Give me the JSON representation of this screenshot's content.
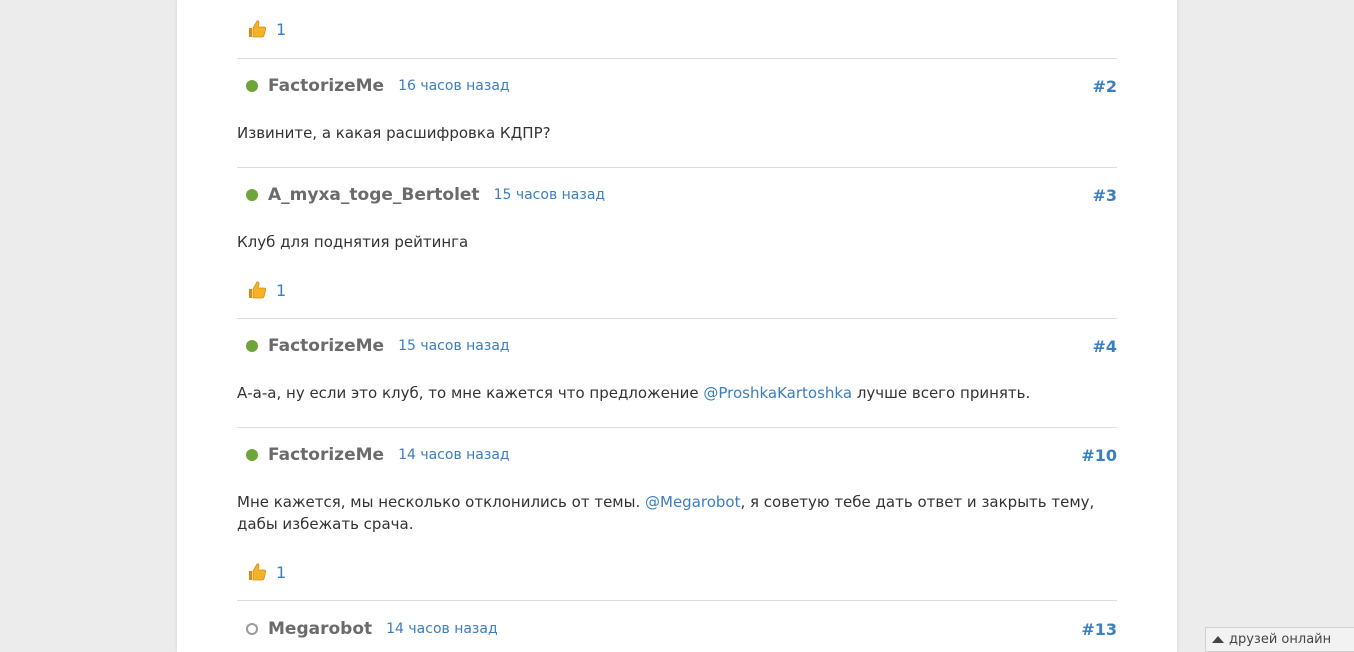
{
  "top_likes": {
    "count": "1"
  },
  "posts": [
    {
      "author": "FactorizeMe",
      "time": "16 часов назад",
      "number": "#2",
      "status": "online",
      "body": "Извините, а какая расшифровка КДПР?",
      "likes": null
    },
    {
      "author": "A_myxa_toge_Bertolet",
      "time": "15 часов назад",
      "number": "#3",
      "status": "online",
      "body": "Клуб для поднятия рейтинга",
      "likes": "1"
    },
    {
      "author": "FactorizeMe",
      "time": "15 часов назад",
      "number": "#4",
      "status": "online",
      "body_before": "А-а-а, ну если это клуб, то мне кажется что предложение ",
      "mention": "@ProshkaKartoshka",
      "body_after": " лучше всего принять.",
      "likes": null
    },
    {
      "author": "FactorizeMe",
      "time": "14 часов назад",
      "number": "#10",
      "status": "online",
      "body_before": "Мне кажется, мы несколько отклонились от темы. ",
      "mention": "@Megarobot",
      "body_after": ", я советую тебе дать ответ и закрыть тему, дабы избежать срача.",
      "likes": "1"
    },
    {
      "author": "Megarobot",
      "time": "14 часов назад",
      "number": "#13",
      "status": "offline"
    }
  ],
  "friends_bar": {
    "label": "друзей онлайн"
  },
  "colors": {
    "link": "#3a7fc1",
    "online": "#6ea53a",
    "thumb": "#f2a51b"
  }
}
